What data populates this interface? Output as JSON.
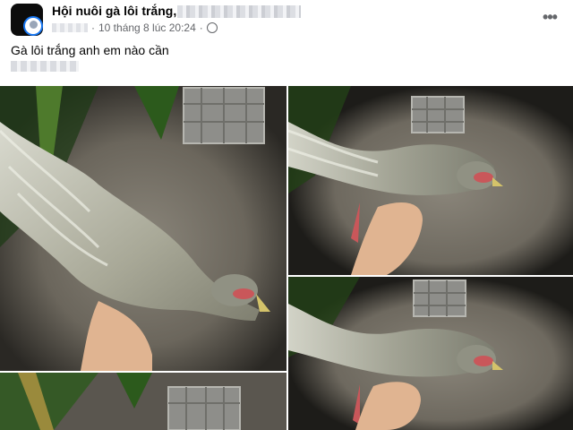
{
  "post": {
    "group_name": "Hội nuôi gà lôi trắng,",
    "time": "10 tháng 8 lúc 20:24",
    "separator": "·",
    "privacy_icon": "globe-icon",
    "more_icon": "more-horizontal-icon",
    "text": "Gà lôi trắng anh em nào cần"
  },
  "photos": [
    {
      "label": "photo-1"
    },
    {
      "label": "photo-2"
    },
    {
      "label": "photo-3"
    },
    {
      "label": "photo-4"
    },
    {
      "label": "photo-5"
    }
  ],
  "colors": {
    "text_primary": "#050505",
    "text_secondary": "#65676b",
    "accent": "#1877f2"
  }
}
